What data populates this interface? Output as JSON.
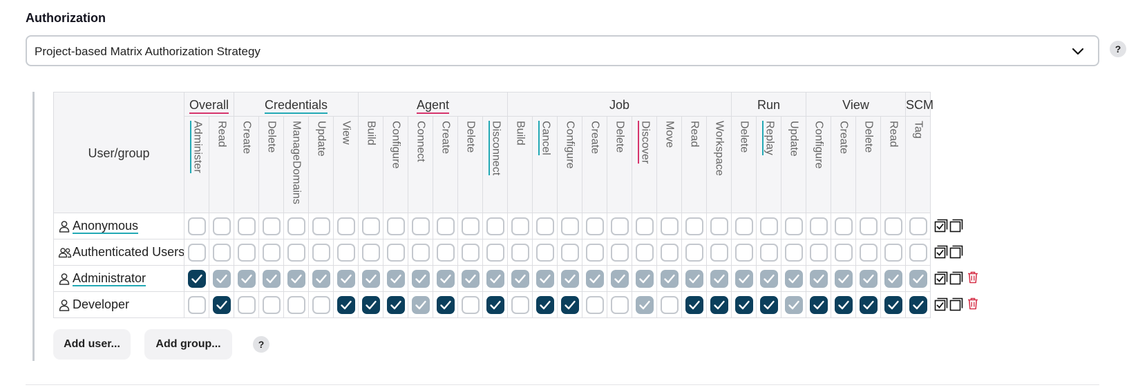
{
  "section": {
    "title": "Authorization"
  },
  "strategy_select": {
    "value": "Project-based Matrix Authorization Strategy"
  },
  "help": {
    "label": "?"
  },
  "matrix": {
    "usergroup_header": "User/group",
    "groups": [
      {
        "label": "Overall",
        "underline": "pink",
        "span": 2
      },
      {
        "label": "Credentials",
        "underline": "teal",
        "span": 5
      },
      {
        "label": "Agent",
        "underline": "pink",
        "span": 6
      },
      {
        "label": "Job",
        "underline": "",
        "span": 9
      },
      {
        "label": "Run",
        "underline": "",
        "span": 3
      },
      {
        "label": "View",
        "underline": "",
        "span": 4
      },
      {
        "label": "SCM",
        "underline": "",
        "span": 1
      }
    ],
    "permissions": [
      {
        "label": "Administer",
        "underline": "teal"
      },
      {
        "label": "Read",
        "underline": ""
      },
      {
        "label": "Create",
        "underline": ""
      },
      {
        "label": "Delete",
        "underline": ""
      },
      {
        "label": "ManageDomains",
        "underline": ""
      },
      {
        "label": "Update",
        "underline": ""
      },
      {
        "label": "View",
        "underline": ""
      },
      {
        "label": "Build",
        "underline": ""
      },
      {
        "label": "Configure",
        "underline": ""
      },
      {
        "label": "Connect",
        "underline": ""
      },
      {
        "label": "Create",
        "underline": ""
      },
      {
        "label": "Delete",
        "underline": ""
      },
      {
        "label": "Disconnect",
        "underline": "teal"
      },
      {
        "label": "Build",
        "underline": ""
      },
      {
        "label": "Cancel",
        "underline": "teal"
      },
      {
        "label": "Configure",
        "underline": ""
      },
      {
        "label": "Create",
        "underline": ""
      },
      {
        "label": "Delete",
        "underline": ""
      },
      {
        "label": "Discover",
        "underline": "pink"
      },
      {
        "label": "Move",
        "underline": ""
      },
      {
        "label": "Read",
        "underline": ""
      },
      {
        "label": "Workspace",
        "underline": ""
      },
      {
        "label": "Delete",
        "underline": ""
      },
      {
        "label": "Replay",
        "underline": "teal"
      },
      {
        "label": "Update",
        "underline": ""
      },
      {
        "label": "Configure",
        "underline": ""
      },
      {
        "label": "Create",
        "underline": ""
      },
      {
        "label": "Delete",
        "underline": ""
      },
      {
        "label": "Read",
        "underline": ""
      },
      {
        "label": "Tag",
        "underline": ""
      }
    ],
    "rows": [
      {
        "name": "Anonymous",
        "type": "user",
        "link": true,
        "deletable": false,
        "states": "uuuuuuuuuuuuuuuuuuuuuuuuuuuuuu"
      },
      {
        "name": "Authenticated Users",
        "type": "group",
        "link": false,
        "deletable": false,
        "states": "uuuuuuuuuuuuuuuuuuuuuuuuuuuuuu"
      },
      {
        "name": "Administrator",
        "type": "user",
        "link": true,
        "deletable": true,
        "states": "ciiiiiiiiiiiiiiiiiiiiiiiiiiiii"
      },
      {
        "name": "Developer",
        "type": "user",
        "link": false,
        "deletable": true,
        "states": "ucuuuucccicucuccuuiucccciccccc"
      }
    ]
  },
  "buttons": {
    "add_user": "Add user...",
    "add_group": "Add group..."
  },
  "colors": {
    "checked": "#0b3f5c",
    "implied": "#a3b3bf",
    "delete": "#d6334a",
    "pink": "#d6336c",
    "teal": "#23a9b5"
  },
  "icons": {
    "select_all": "select-all-icon",
    "unselect_all": "unselect-all-icon",
    "delete": "trash-icon"
  }
}
